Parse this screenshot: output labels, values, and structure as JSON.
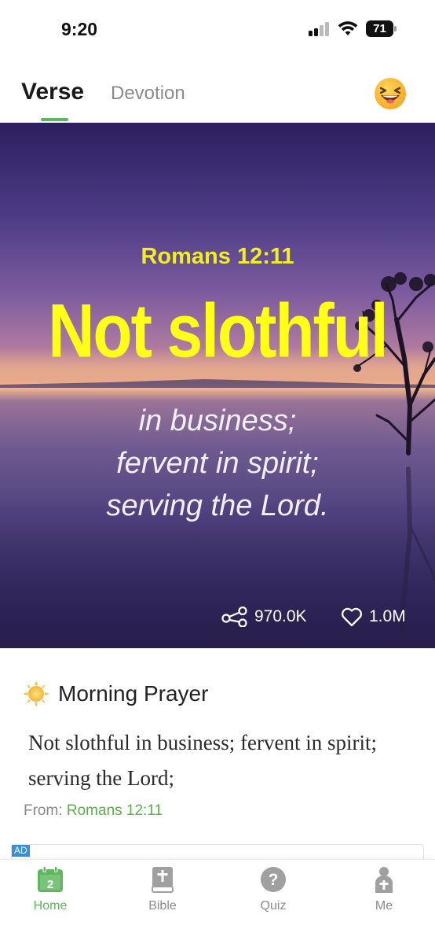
{
  "status_bar": {
    "time": "9:20",
    "battery_level": "71"
  },
  "tabs": [
    {
      "label": "Verse",
      "active": true
    },
    {
      "label": "Devotion",
      "active": false
    }
  ],
  "hero": {
    "reference": "Romans 12:11",
    "headline": "Not slothful",
    "lines": [
      "in business;",
      "fervent in spirit;",
      "serving the Lord."
    ],
    "share_count": "970.0K",
    "like_count": "1.0M"
  },
  "prayer": {
    "title": "Morning Prayer",
    "body": "Not slothful in business; fervent in spirit; serving the Lord;",
    "from_label": "From:",
    "from_ref": "Romans 12:11"
  },
  "ad": {
    "badge": "AD"
  },
  "nav": {
    "items": [
      {
        "label": "Home",
        "icon": "calendar-icon",
        "badge": "2",
        "active": true
      },
      {
        "label": "Bible",
        "icon": "bible-icon",
        "active": false
      },
      {
        "label": "Quiz",
        "icon": "question-icon",
        "active": false
      },
      {
        "label": "Me",
        "icon": "person-icon",
        "active": false
      }
    ]
  },
  "colors": {
    "accent": "#5cb85c",
    "headline_yellow": "#ffff17",
    "link_green": "#5cae4a"
  }
}
